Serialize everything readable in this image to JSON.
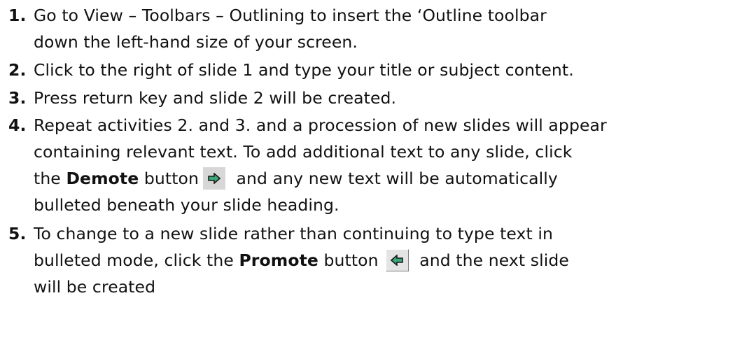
{
  "steps": [
    {
      "num": "1.",
      "lines": [
        "Go to View – Toolbars – Outlining to insert the ‘Outline toolbar",
        "down the left-hand size of your screen."
      ]
    },
    {
      "num": "2.",
      "lines": [
        "Click to the right of slide 1 and type your title or subject content."
      ]
    },
    {
      "num": "3.",
      "lines": [
        "Press return key and slide 2 will be created."
      ]
    },
    {
      "num": "4.",
      "lines": [
        "Repeat activities 2. and 3. and a procession of new slides will appear",
        "containing relevant text.  To add additional text to any slide, click"
      ],
      "demote_prefix": "the ",
      "demote_bold": "Demote",
      "demote_mid": " button",
      "demote_suffix": " and any new text will be automatically",
      "last_line": "bulleted beneath your slide heading."
    },
    {
      "num": "5.",
      "lines": [
        "To change to a new slide rather than continuing to type text in"
      ],
      "promote_prefix": "bulleted mode, click the ",
      "promote_bold": "Promote",
      "promote_mid": " button",
      "promote_suffix": " and the next slide",
      "last_line": "will be created"
    }
  ],
  "icons": {
    "demote": "right-arrow-icon",
    "promote": "left-arrow-icon"
  },
  "colors": {
    "arrow_fill": "#3aa878",
    "arrow_outline": "#1a1a1a",
    "button_face": "#d7d7d7"
  }
}
